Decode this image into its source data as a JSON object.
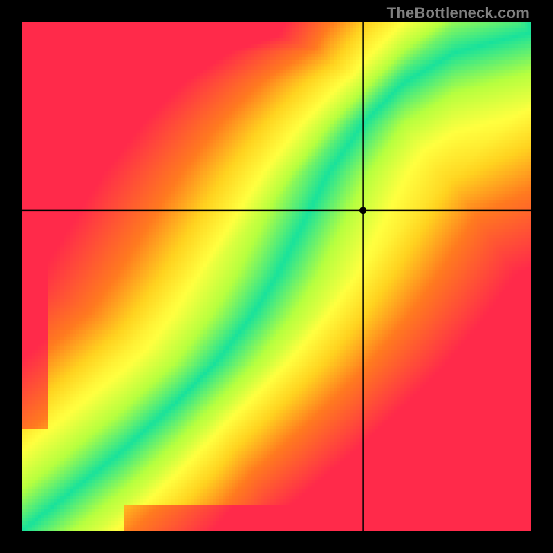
{
  "watermark": "TheBottleneck.com",
  "chart_data": {
    "type": "heatmap",
    "title": "",
    "xlabel": "",
    "ylabel": "",
    "xlim": [
      0,
      1
    ],
    "ylim": [
      0,
      1
    ],
    "grid": false,
    "legend": false,
    "notes": "Color encodes match quality: green = balanced (near an S-shaped ideal curve from bottom-left to top-right), yellow = moderate mismatch, red = severe mismatch.",
    "crosshair": {
      "x": 0.67,
      "y": 0.63
    },
    "marker": {
      "x": 0.67,
      "y": 0.63
    },
    "colormap": {
      "stops": [
        {
          "t": 0.0,
          "color": "#ff2a4a"
        },
        {
          "t": 0.35,
          "color": "#ff7a1f"
        },
        {
          "t": 0.55,
          "color": "#ffd21f"
        },
        {
          "t": 0.72,
          "color": "#ffff3f"
        },
        {
          "t": 0.85,
          "color": "#b6ff3f"
        },
        {
          "t": 1.0,
          "color": "#18e29b"
        }
      ]
    },
    "ideal_curve": {
      "type": "piecewise",
      "points": [
        [
          0.0,
          0.0
        ],
        [
          0.1,
          0.08
        ],
        [
          0.2,
          0.16
        ],
        [
          0.3,
          0.25
        ],
        [
          0.38,
          0.33
        ],
        [
          0.45,
          0.42
        ],
        [
          0.5,
          0.5
        ],
        [
          0.55,
          0.6
        ],
        [
          0.6,
          0.7
        ],
        [
          0.67,
          0.8
        ],
        [
          0.75,
          0.88
        ],
        [
          0.85,
          0.94
        ],
        [
          1.0,
          0.98
        ]
      ],
      "tolerance": 0.08
    },
    "resolution": 160
  }
}
